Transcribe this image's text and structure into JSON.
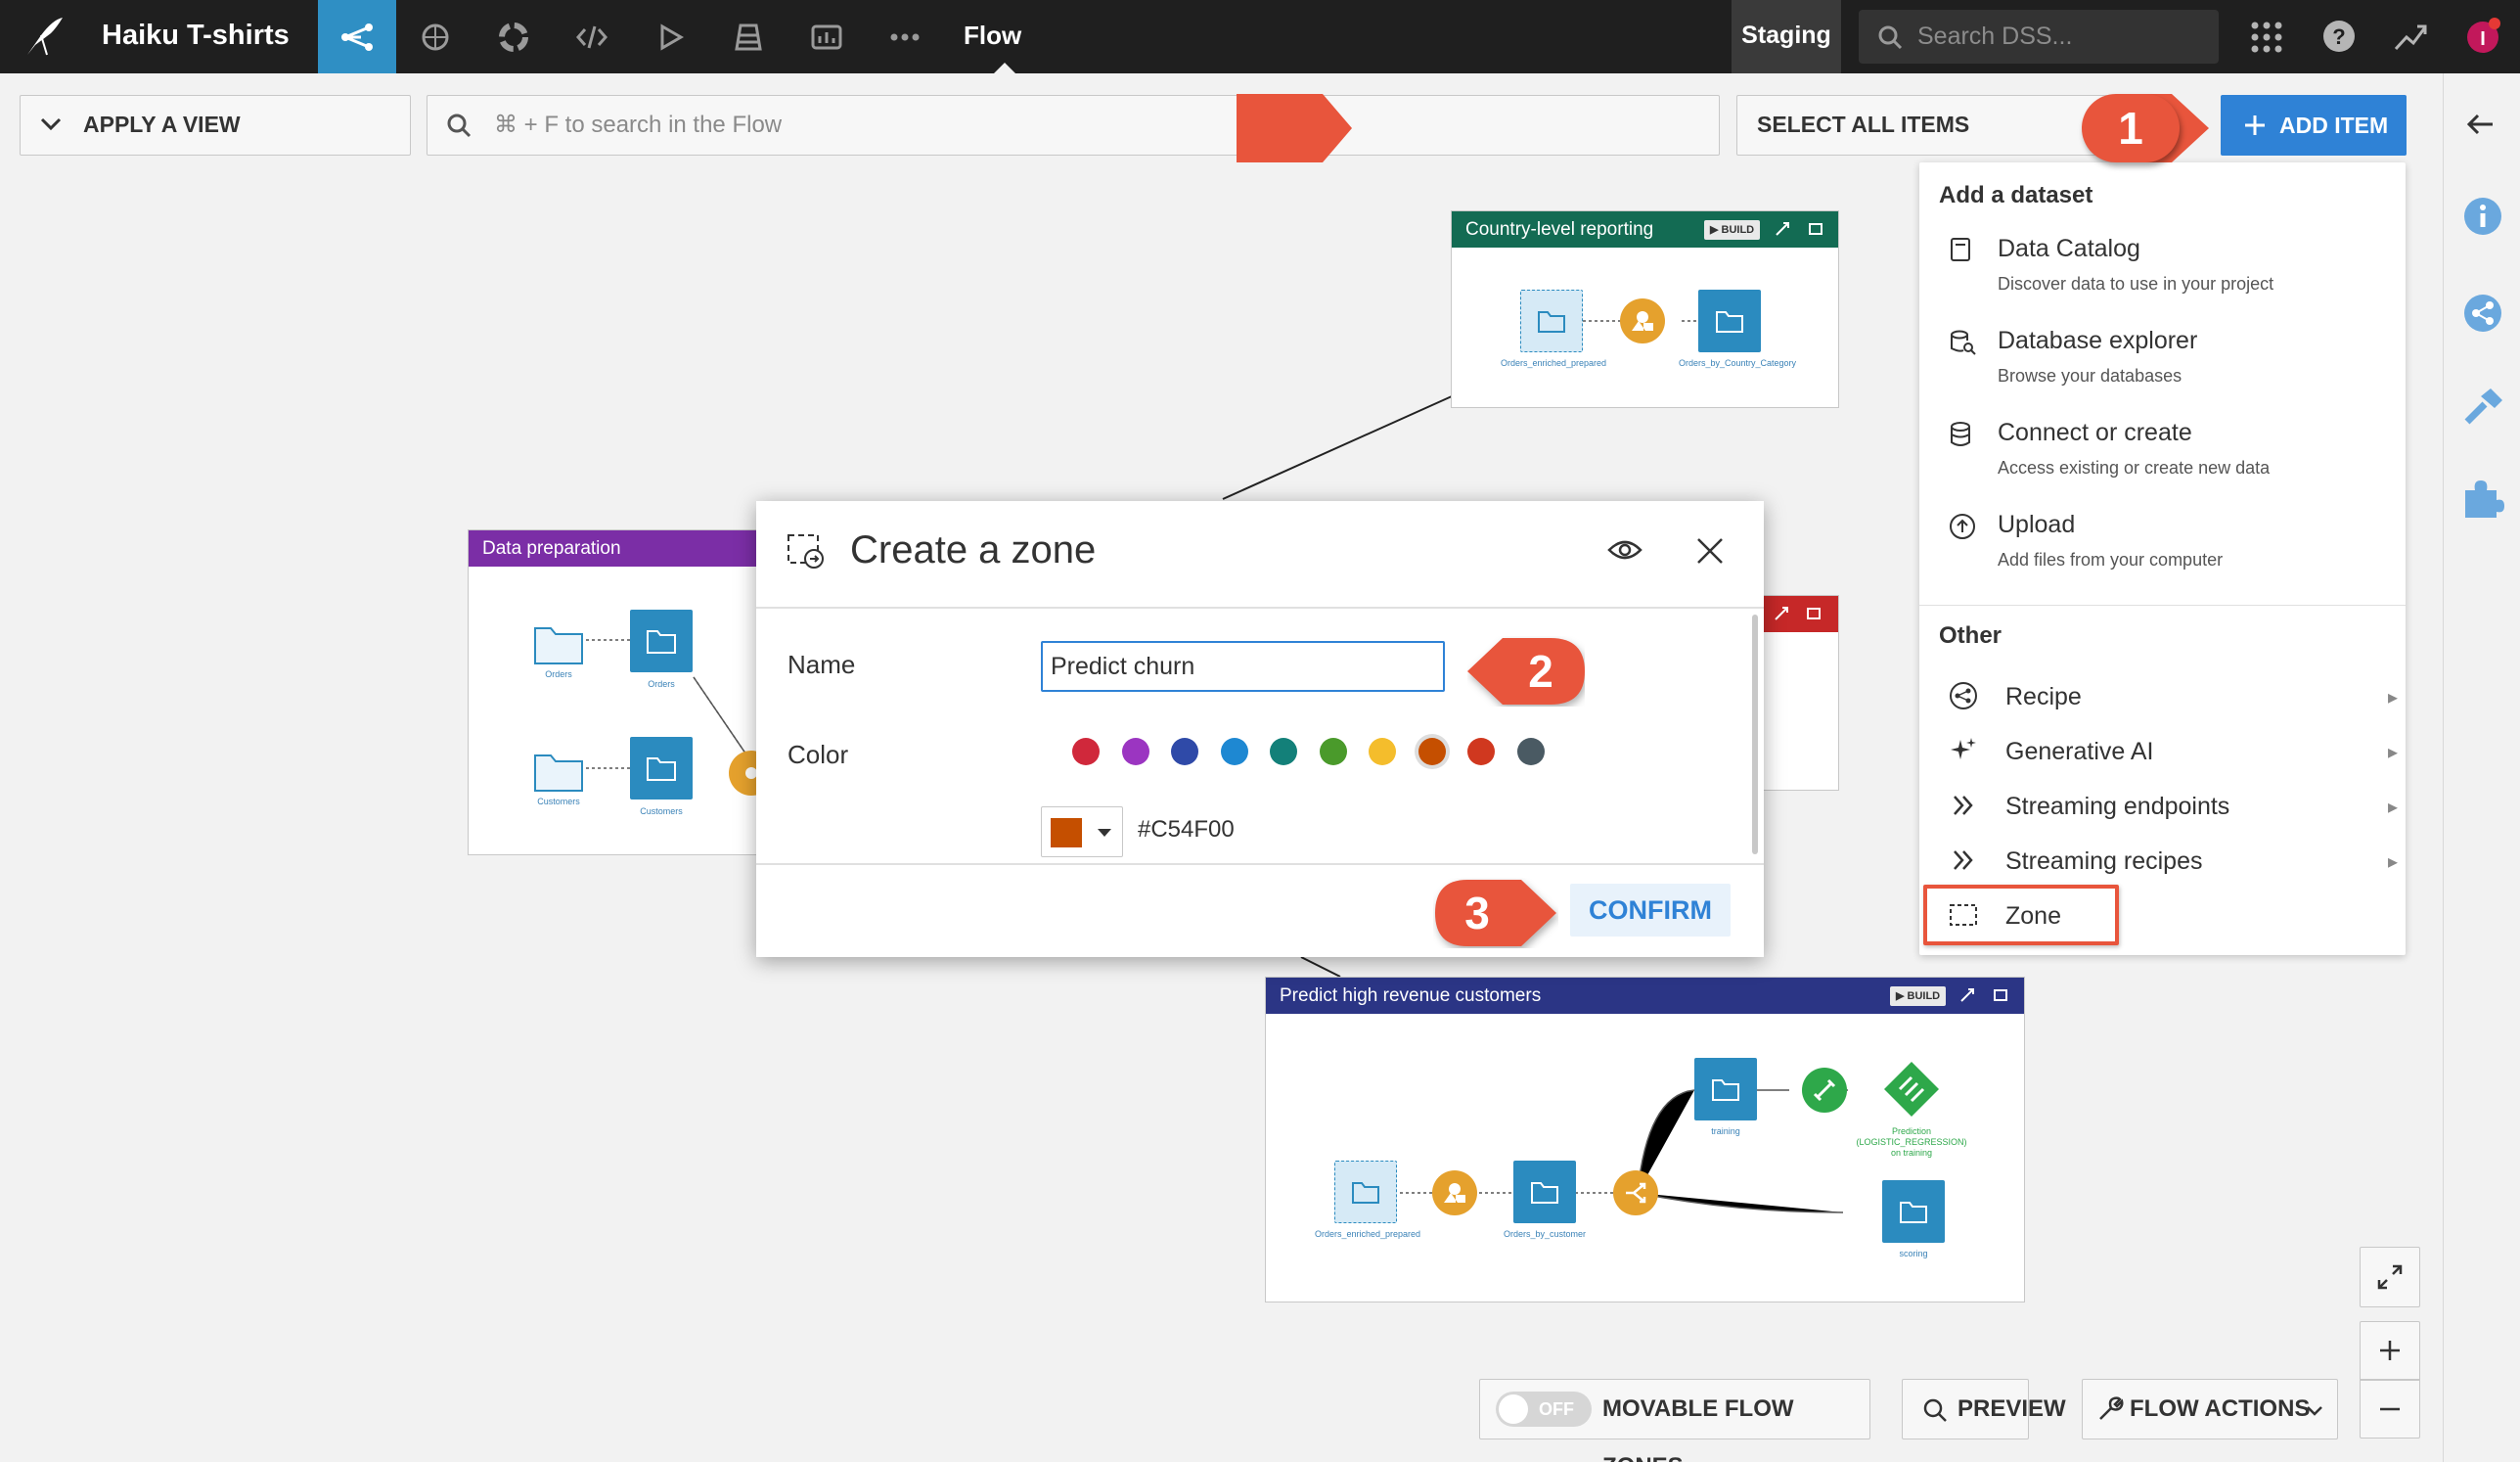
{
  "header": {
    "project_title": "Haiku T-shirts",
    "page_title": "Flow",
    "environment": "Staging",
    "search_placeholder": "Search DSS..."
  },
  "toolbar": {
    "apply_view": "APPLY A VIEW",
    "flow_search_placeholder": "⌘ + F to search in the Flow",
    "select_all": "SELECT ALL ITEMS",
    "add_item": "ADD ITEM"
  },
  "dropdown": {
    "section_dataset": "Add a dataset",
    "items": [
      {
        "label": "Data Catalog",
        "sub": "Discover data to use in your project"
      },
      {
        "label": "Database explorer",
        "sub": "Browse your databases"
      },
      {
        "label": "Connect or create",
        "sub": "Access existing or create new data"
      },
      {
        "label": "Upload",
        "sub": "Add files from your computer"
      }
    ],
    "section_other": "Other",
    "other_items": [
      "Recipe",
      "Generative AI",
      "Streaming endpoints",
      "Streaming recipes",
      "Zone"
    ]
  },
  "zones": {
    "country": {
      "title": "Country-level reporting",
      "build": "BUILD",
      "ds1": "Orders_enriched_prepared",
      "ds2": "Orders_by_Country_Category"
    },
    "dataprep": {
      "title": "Data preparation",
      "ds1": "Orders",
      "ds2": "Orders",
      "ds3": "Customers",
      "ds4": "Customers"
    },
    "predict": {
      "title": "Predict high revenue customers",
      "build": "BUILD",
      "ds1": "Orders_enriched_prepared",
      "ds2": "Orders_by_customer",
      "ds3": "training",
      "ds4": "Prediction (LOGISTIC_REGRESSION) on training",
      "ds5": "scoring"
    }
  },
  "modal": {
    "title": "Create a zone",
    "name_label": "Name",
    "name_value": "Predict churn",
    "color_label": "Color",
    "hex_value": "#C54F00",
    "confirm": "CONFIRM",
    "swatches": [
      "#d0283b",
      "#9b35c1",
      "#2f4aa8",
      "#1e88d2",
      "#138079",
      "#4a9a2b",
      "#f4bd2c",
      "#c54f00",
      "#d0381f",
      "#4a5a63"
    ],
    "selected_color": "#C54F00"
  },
  "annotations": {
    "step1": "1",
    "step2": "2",
    "step3": "3"
  },
  "bottom": {
    "toggle_state": "OFF",
    "movable_zones": "MOVABLE FLOW ZONES",
    "preview": "PREVIEW",
    "flow_actions": "FLOW ACTIONS"
  },
  "colors": {
    "topbar": "#1f1f1f",
    "accent": "#2f8fc4",
    "primary": "#2f82d6",
    "badge": "#e8553c",
    "dataprep": "#7b2ea6",
    "predict": "#2b3585",
    "country": "#136b53",
    "zone_red": "#c62828"
  }
}
